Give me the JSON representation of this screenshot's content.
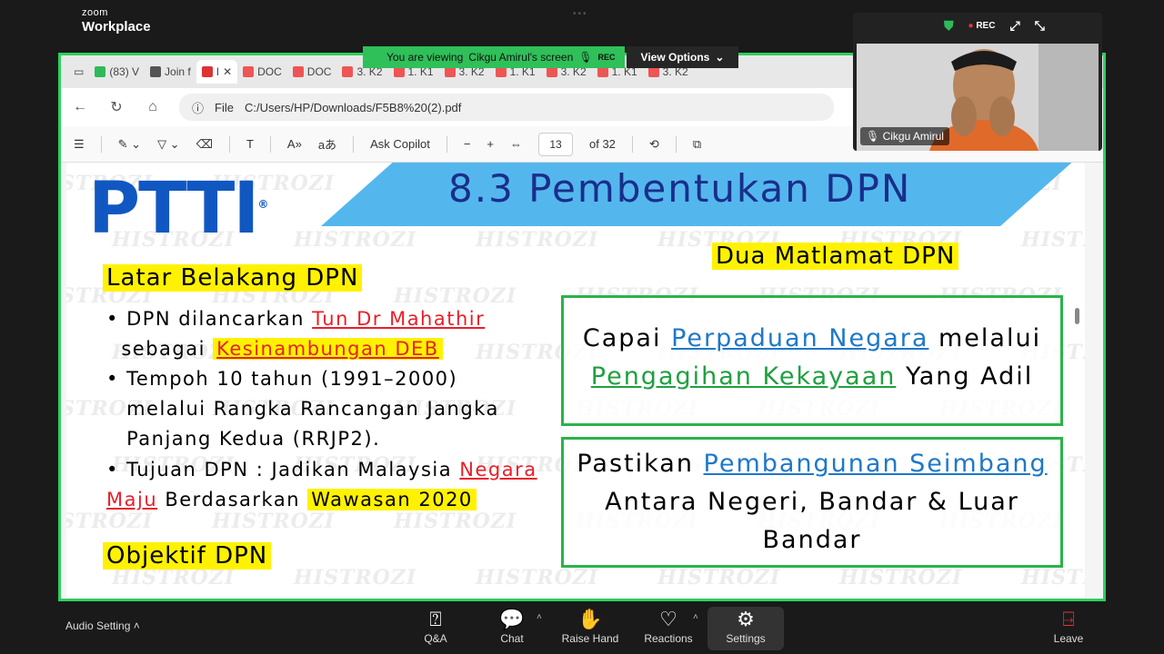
{
  "zoom": {
    "brand_top": "zoom",
    "brand_bottom": "Workplace",
    "viewing_text": "You are viewing",
    "viewing_name": "Cikgu Amirul's screen",
    "rec_label": "REC",
    "view_options": "View Options"
  },
  "browser": {
    "tabs": [
      {
        "label": "(83) V",
        "color": "#2dbb5a"
      },
      {
        "label": "Join f",
        "color": "#555"
      },
      {
        "label": "I",
        "color": "#d33"
      },
      {
        "label": "DOC",
        "color": "#e55"
      },
      {
        "label": "DOC",
        "color": "#e55"
      },
      {
        "label": "3. K2",
        "color": "#e55"
      },
      {
        "label": "1. K1",
        "color": "#e55"
      },
      {
        "label": "3. K2",
        "color": "#e55"
      },
      {
        "label": "1. K1",
        "color": "#e55"
      },
      {
        "label": "3. K2",
        "color": "#e55"
      },
      {
        "label": "1. K1",
        "color": "#e55"
      },
      {
        "label": "3. K2",
        "color": "#e55"
      }
    ],
    "file_label": "File",
    "url": "C:/Users/HP/Downloads/F5B8%20(2).pdf",
    "ask_copilot": "Ask Copilot",
    "page": "13",
    "page_of": "of 32"
  },
  "slide": {
    "logo": "PTTI",
    "registered": "®",
    "title": "8.3 Pembentukan DPN",
    "left_heading": "Latar Belakang DPN",
    "b1_a": "DPN dilancarkan ",
    "b1_b": "Tun Dr Mahathir",
    "b1_c": "sebagai ",
    "b1_d": "Kesinambungan DEB",
    "b2": "Tempoh 10 tahun (1991–2000) melalui Rangka Rancangan Jangka Panjang Kedua (RRJP2).",
    "b3_a": "Tujuan DPN : Jadikan Malaysia ",
    "b3_b": "Negara Maju",
    "b3_c": " Berdasarkan ",
    "b3_d": "Wawasan 2020",
    "objektif": "Objektif DPN",
    "right_heading": "Dua Matlamat DPN",
    "box1_a": "Capai ",
    "box1_b": "Perpaduan Negara",
    "box1_c": " melalui ",
    "box1_d": "Pengagihan Kekayaan",
    "box1_e": " Yang Adil",
    "box2_a": "Pastikan ",
    "box2_b": "Pembangunan Seimbang",
    "box2_c": " Antara Negeri, Bandar & Luar Bandar",
    "watermark": "HISTROZI"
  },
  "video": {
    "name": "Cikgu Amirul",
    "rec": "REC"
  },
  "bottom": {
    "audio": "Audio Setting",
    "qa": "Q&A",
    "chat": "Chat",
    "raise": "Raise Hand",
    "reactions": "Reactions",
    "settings": "Settings",
    "leave": "Leave"
  }
}
